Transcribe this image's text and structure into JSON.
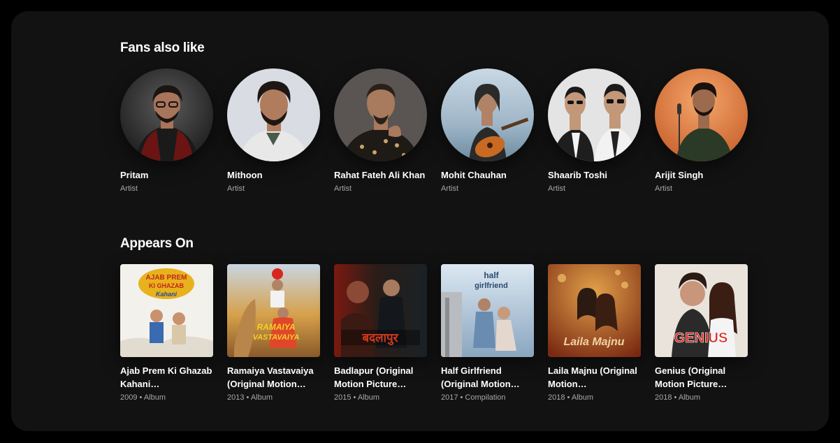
{
  "fans_also_like": {
    "title": "Fans also like",
    "artists": [
      {
        "name": "Pritam",
        "type": "Artist",
        "bg": "#3a3a3a",
        "skin": "#a8745a",
        "shirt": "#6a1414"
      },
      {
        "name": "Mithoon",
        "type": "Artist",
        "bg": "#d9dce2",
        "skin": "#b07c5e",
        "shirt": "#e8e8e8"
      },
      {
        "name": "Rahat Fateh Ali Khan",
        "type": "Artist",
        "bg": "#5a5552",
        "skin": "#a87a5e",
        "shirt": "#1e1a16"
      },
      {
        "name": "Mohit Chauhan",
        "type": "Artist",
        "bg": "#9fb6c8",
        "skin": "#b08266",
        "shirt": "#2a2a2a"
      },
      {
        "name": "Shaarib Toshi",
        "type": "Artist",
        "bg": "#e4e4e4",
        "skin": "#c29878",
        "shirt": "#1e1e1e"
      },
      {
        "name": "Arijit Singh",
        "type": "Artist",
        "bg": "#e0804c",
        "skin": "#9c6a4c",
        "shirt": "#2b3a26"
      }
    ]
  },
  "appears_on": {
    "title": "Appears On",
    "albums": [
      {
        "title": "Ajab Prem Ki Ghazab Kahani…",
        "meta": "2009 • Album",
        "cover_text": "AJAB PREM KI GHAZAB Kahani",
        "bg": "#f3f1ec",
        "accent": "#e8b21c"
      },
      {
        "title": "Ramaiya Vastavaiya (Original Motion…",
        "meta": "2013 • Album",
        "cover_text": "RAMAIYA VASTAVAIYA",
        "bg": "#d6a04a",
        "accent": "#e0472a"
      },
      {
        "title": "Badlapur (Original Motion Picture…",
        "meta": "2015 • Album",
        "cover_text": "बदलापुर",
        "bg": "#2a1d18",
        "accent": "#d33a1e"
      },
      {
        "title": "Half Girlfriend (Original Motion…",
        "meta": "2017 • Compilation",
        "cover_text": "half girlfriend",
        "bg": "#a9c4dc",
        "accent": "#2a4a6e"
      },
      {
        "title": "Laila Majnu (Original Motion…",
        "meta": "2018 • Album",
        "cover_text": "Laila Majnu",
        "bg": "#b5552a",
        "accent": "#f2d2a4"
      },
      {
        "title": "Genius (Original Motion Picture…",
        "meta": "2018 • Album",
        "cover_text": "GENIUS",
        "bg": "#e9e3dc",
        "accent": "#d8261e"
      }
    ]
  }
}
